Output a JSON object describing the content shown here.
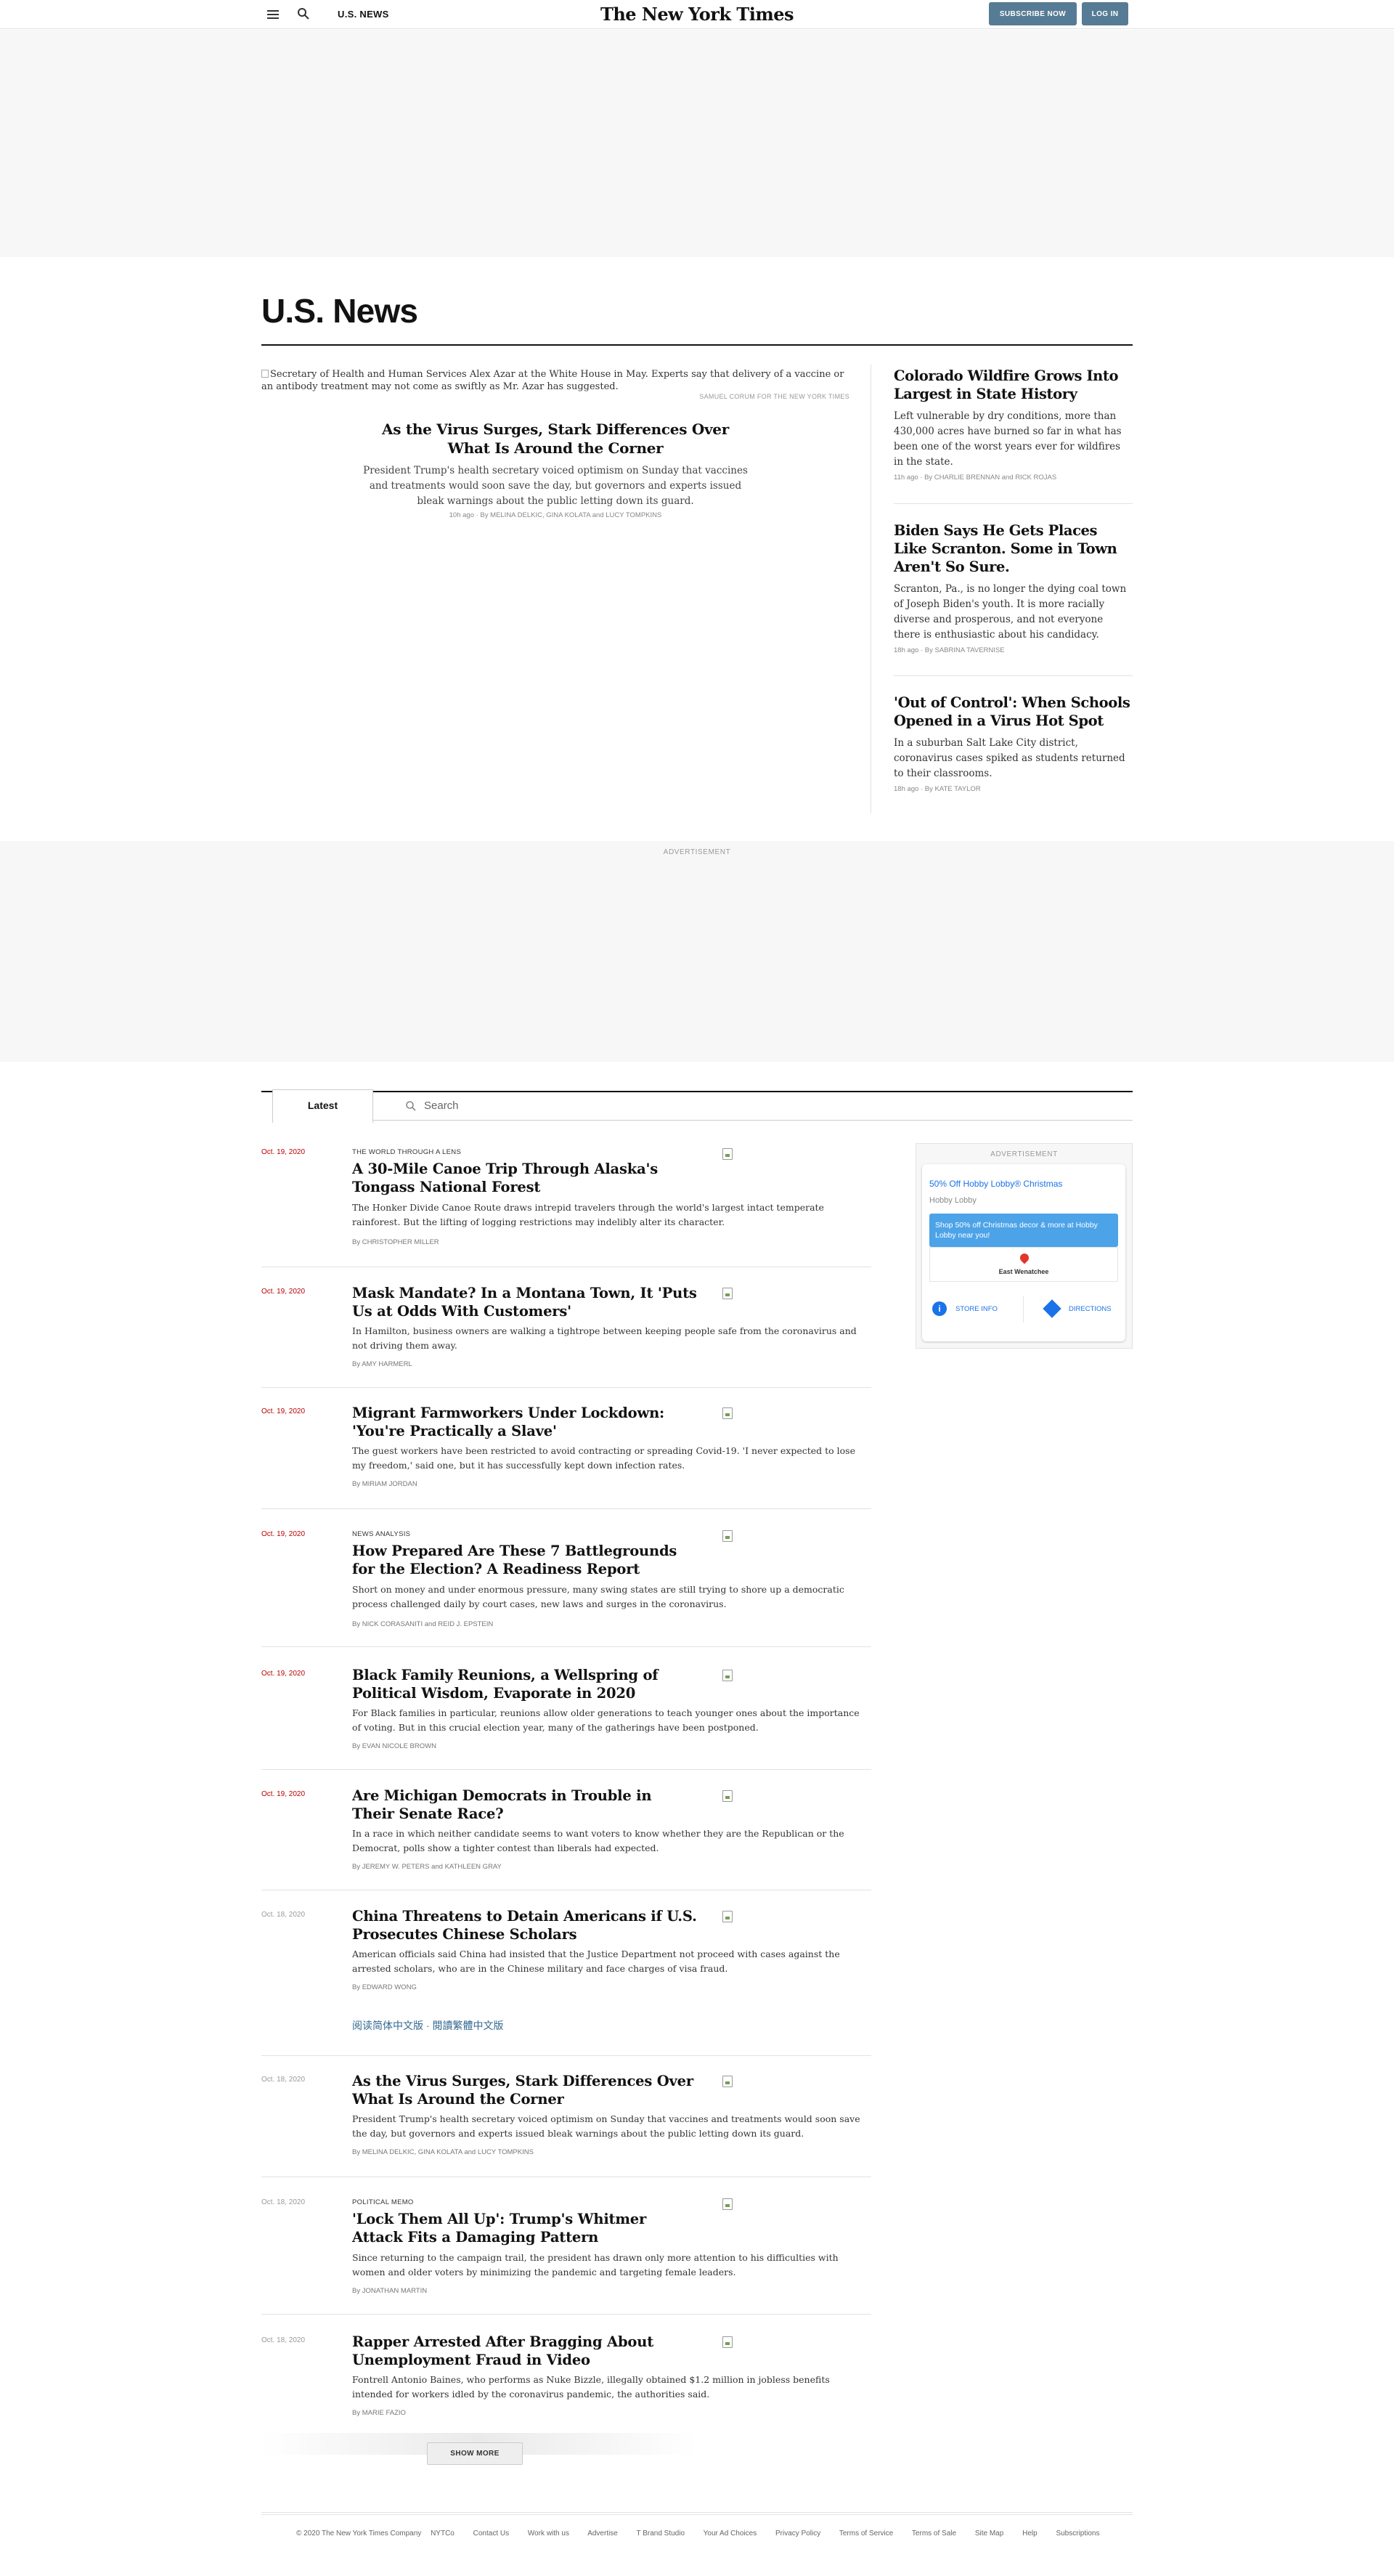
{
  "header": {
    "section": "U.S. NEWS",
    "logo": "The New York Times",
    "subscribe": "SUBSCRIBE NOW",
    "login": "LOG IN",
    "menu_icon": "hamburger-menu-icon",
    "search_icon": "search-icon"
  },
  "page_title": "U.S. News",
  "lead": {
    "image_alt": "Secretary of Health and Human Services Alex Azar at the White House in May. Experts say that delivery of a vaccine or an antibody treatment may not come as swiftly as Mr. Azar has suggested.",
    "credit": "SAMUEL CORUM FOR THE NEW YORK TIMES",
    "headline": "As the Virus Surges, Stark Differences Over What Is Around the Corner",
    "summary": "President Trump's health secretary voiced optimism on Sunday that vaccines and treatments would soon save the day, but governors and experts issued bleak warnings about the public letting down its guard.",
    "meta": "10h ago  ·  By MELINA DELKIC, GINA KOLATA and LUCY TOMPKINS"
  },
  "side_stories": [
    {
      "headline": "Colorado Wildfire Grows Into Largest in State History",
      "summary": "Left vulnerable by dry conditions, more than 430,000 acres have burned so far in what has been one of the worst years ever for wildfires in the state.",
      "meta": "11h ago  ·  By CHARLIE BRENNAN and RICK ROJAS"
    },
    {
      "headline": "Biden Says He Gets Places Like Scranton. Some in Town Aren't So Sure.",
      "summary": "Scranton, Pa., is no longer the dying coal town of Joseph Biden's youth. It is more racially diverse and prosperous, and not everyone there is enthusiastic about his candidacy.",
      "meta": "18h ago  ·  By SABRINA TAVERNISE"
    },
    {
      "headline": "'Out of Control': When Schools Opened in a Virus Hot Spot",
      "summary": "In a suburban Salt Lake City district, coronavirus cases spiked as students returned to their classrooms.",
      "meta": "18h ago  ·  By KATE TAYLOR"
    }
  ],
  "ads": {
    "label": "ADVERTISEMENT",
    "rail": {
      "title": "50% Off Hobby Lobby® Christmas",
      "brand": "Hobby Lobby",
      "banner": "Shop 50% off Christmas decor & more at Hobby Lobby near you!",
      "city": "East Wenatchee",
      "store_info": "STORE INFO",
      "directions": "DIRECTIONS",
      "adchoices": "▷ ✕"
    }
  },
  "stream": {
    "tab_latest": "Latest",
    "search_placeholder": "Search",
    "items": [
      {
        "date": "Oct. 19, 2020",
        "kicker": "THE WORLD THROUGH A LENS",
        "headline": "A 30-Mile Canoe Trip Through Alaska's Tongass National Forest",
        "summary": "The Honker Divide Canoe Route draws intrepid travelers through the world's largest intact temperate rainforest. But the lifting of logging restrictions may indelibly alter its character.",
        "byline": "By CHRISTOPHER MILLER"
      },
      {
        "date": "Oct. 19, 2020",
        "kicker": "",
        "headline": "Mask Mandate? In a Montana Town, It 'Puts Us at Odds With Customers'",
        "summary": "In Hamilton, business owners are walking a tightrope between keeping people safe from the coronavirus and not driving them away.",
        "byline": "By AMY HARMERL"
      },
      {
        "date": "Oct. 19, 2020",
        "kicker": "",
        "headline": "Migrant Farmworkers Under Lockdown: 'You're Practically a Slave'",
        "summary": "The guest workers have been restricted to avoid contracting or spreading Covid-19. 'I never expected to lose my freedom,' said one, but it has successfully kept down infection rates.",
        "byline": "By MIRIAM JORDAN"
      },
      {
        "date": "Oct. 19, 2020",
        "kicker": "NEWS ANALYSIS",
        "headline": "How Prepared Are These 7 Battlegrounds for the Election? A Readiness Report",
        "summary": "Short on money and under enormous pressure, many swing states are still trying to shore up a democratic process challenged daily by court cases, new laws and surges in the coronavirus.",
        "byline": "By NICK CORASANITI and REID J. EPSTEIN"
      },
      {
        "date": "Oct. 19, 2020",
        "kicker": "",
        "headline": "Black Family Reunions, a Wellspring of Political Wisdom, Evaporate in 2020",
        "summary": "For Black families in particular, reunions allow older generations to teach younger ones about the importance of voting. But in this crucial election year, many of the gatherings have been postponed.",
        "byline": "By EVAN NICOLE BROWN"
      },
      {
        "date": "Oct. 19, 2020",
        "kicker": "",
        "headline": "Are Michigan Democrats in Trouble in Their Senate Race?",
        "summary": "In a race in which neither candidate seems to want voters to know whether they are the Republican or the Democrat, polls show a tighter contest than liberals had expected.",
        "byline": "By JEREMY W. PETERS and KATHLEEN GRAY"
      },
      {
        "date": "Oct. 18, 2020",
        "kicker": "",
        "headline": "China Threatens to Detain Americans if U.S. Prosecutes Chinese Scholars",
        "summary": "American officials said China had insisted that the Justice Department not proceed with cases against the arrested scholars, who are in the Chinese military and face charges of visa fraud.",
        "byline": "By EDWARD WONG",
        "links": "阅读简体中文版  ·  閱讀繁體中文版"
      },
      {
        "date": "Oct. 18, 2020",
        "kicker": "",
        "headline": "As the Virus Surges, Stark Differences Over What Is Around the Corner",
        "summary": "President Trump's health secretary voiced optimism on Sunday that vaccines and treatments would soon save the day, but governors and experts issued bleak warnings about the public letting down its guard.",
        "byline": "By MELINA DELKIC, GINA KOLATA and LUCY TOMPKINS"
      },
      {
        "date": "Oct. 18, 2020",
        "kicker": "POLITICAL MEMO",
        "headline": "'Lock Them All Up': Trump's Whitmer Attack Fits a Damaging Pattern",
        "summary": "Since returning to the campaign trail, the president has drawn only more attention to his difficulties with women and older voters by minimizing the pandemic and targeting female leaders.",
        "byline": "By JONATHAN MARTIN"
      },
      {
        "date": "Oct. 18, 2020",
        "kicker": "",
        "headline": "Rapper Arrested After Bragging About Unemployment Fraud in Video",
        "summary": "Fontrell Antonio Baines, who performs as Nuke Bizzle, illegally obtained $1.2 million in jobless benefits intended for workers idled by the coronavirus pandemic, the authorities said.",
        "byline": "By MARIE FAZIO"
      }
    ],
    "show_more": "SHOW MORE"
  },
  "footer": {
    "copyright": "© 2020 The New York Times Company",
    "links": [
      "NYTCo",
      "Contact Us",
      "Work with us",
      "Advertise",
      "T Brand Studio",
      "Your Ad Choices",
      "Privacy Policy",
      "Terms of Service",
      "Terms of Sale",
      "Site Map",
      "Help",
      "Subscriptions"
    ]
  },
  "colors": {
    "accent": "#567b95",
    "date_red": "#b80000",
    "link_blue": "#326891"
  }
}
